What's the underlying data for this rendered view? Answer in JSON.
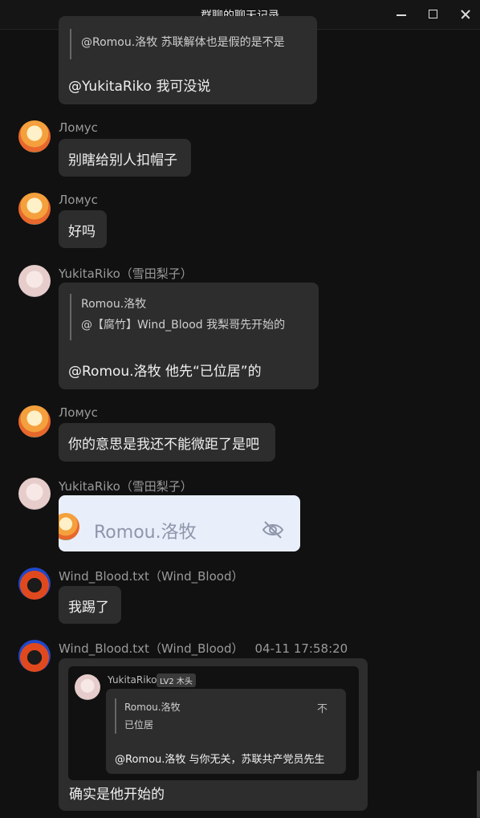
{
  "window": {
    "title": "群聊的聊天记录"
  },
  "messages": [
    {
      "quote_line": "@Romou.洛牧 苏联解体也是假的是不是",
      "text": "@YukitaRiko 我可没说"
    },
    {
      "sender": "Ломус",
      "text": "别瞎给别人扣帽子"
    },
    {
      "sender": "Ломус",
      "text": "好吗"
    },
    {
      "sender": "YukitaRiko（雪田梨子）",
      "quote_name": "Romou.洛牧",
      "quote_line": "@【腐竹】Wind_Blood 我梨哥先开始的",
      "text": "@Romou.洛牧 他先“已位居”的"
    },
    {
      "sender": "Ломус",
      "text": "你的意思是我还不能微距了是吧"
    },
    {
      "sender": "YukitaRiko（雪田梨子）",
      "card_text": "Romou.洛牧"
    },
    {
      "sender": "Wind_Blood.txt（Wind_Blood）",
      "text": "我踢了"
    },
    {
      "sender": "Wind_Blood.txt（Wind_Blood）",
      "time": "04-11 17:58:20",
      "forward": {
        "name": "YukitaRiko",
        "level": "LV2 木头",
        "quote_name": "Romou.洛牧",
        "quote_line": "已位居",
        "close_glyph": "不",
        "reply": "@Romou.洛牧 与你无关，苏联共产党员先生"
      },
      "text": "确实是他开始的"
    }
  ]
}
